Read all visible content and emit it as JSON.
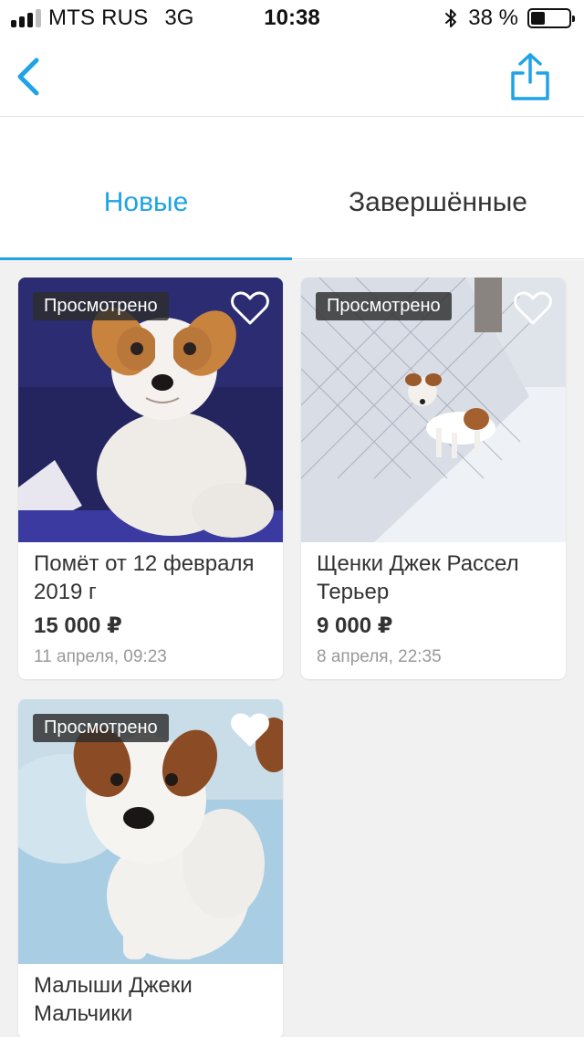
{
  "status_bar": {
    "carrier": "MTS RUS",
    "network": "3G",
    "time": "10:38",
    "battery_percent": "38 %",
    "battery_level": 0.38
  },
  "nav": {
    "back_icon": "chevron-left-icon",
    "share_icon": "share-icon",
    "accent_color": "#1fa3e6"
  },
  "tabs": [
    {
      "label": "Новые",
      "active": true
    },
    {
      "label": "Завершённые",
      "active": false
    }
  ],
  "listings": [
    {
      "title": "Помёт от 12 февраля 2019 г",
      "price": "15 000 ₽",
      "date": "11 апреля, 09:23",
      "badge": "Просмотрено",
      "favorited": false
    },
    {
      "title": "Щенки Джек Рассел Терьер",
      "price": "9 000 ₽",
      "date": "8 апреля, 22:35",
      "badge": "Просмотрено",
      "favorited": false
    },
    {
      "title": "Малыши Джеки Мальчики",
      "badge": "Просмотрено",
      "favorited": true
    }
  ]
}
